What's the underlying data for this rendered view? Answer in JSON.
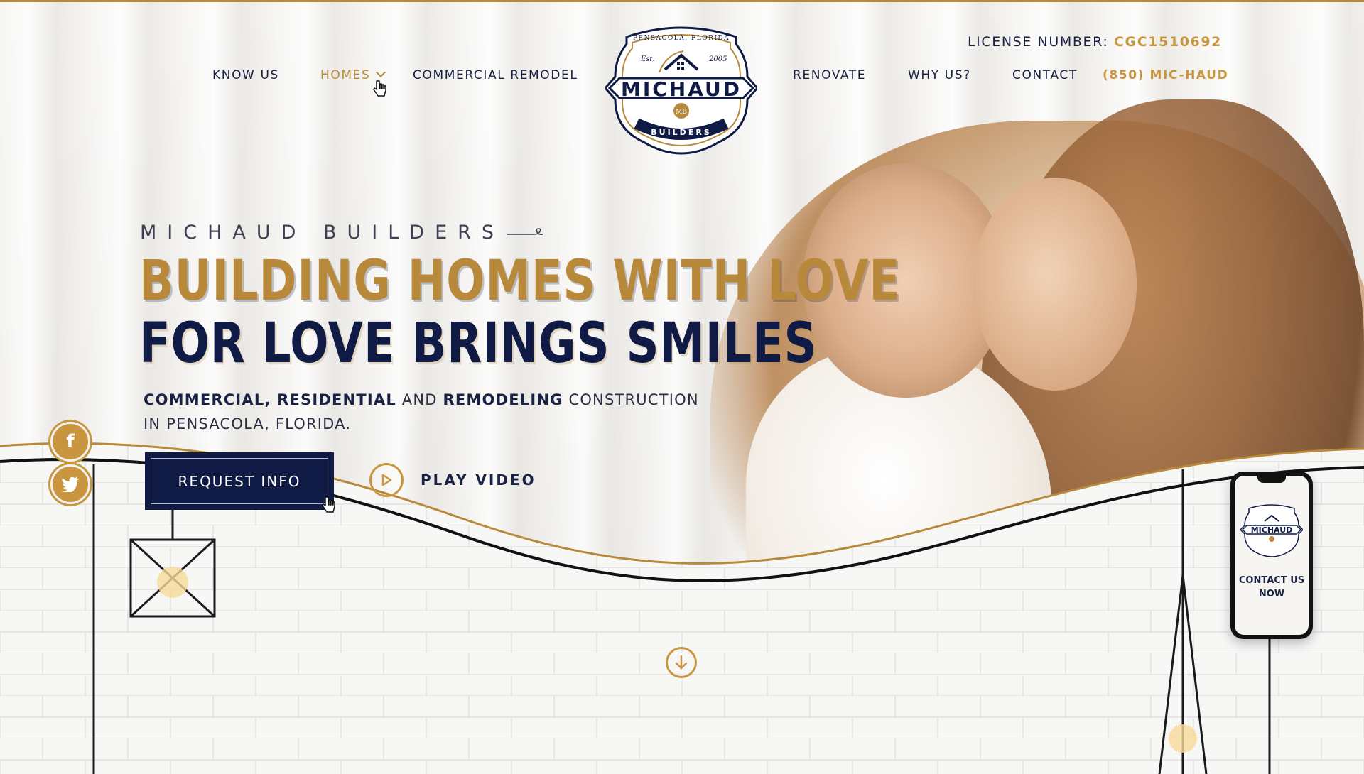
{
  "brand": {
    "logo_top_text": "PENSACOLA, FLORIDA",
    "logo_est": "Est.",
    "logo_year": "2005",
    "logo_name": "MICHAUD",
    "logo_monogram": "MB",
    "logo_bottom_text": "BUILDERS"
  },
  "license": {
    "label": "LICENSE NUMBER: ",
    "number": "CGC1510692"
  },
  "nav": {
    "left": [
      "KNOW US",
      "HOMES",
      "COMMERCIAL REMODEL"
    ],
    "right": [
      "RENOVATE",
      "WHY US?",
      "CONTACT"
    ],
    "phone": "(850) MIC-HAUD"
  },
  "hero": {
    "eyebrow": "MICHAUD BUILDERS",
    "headline_1": "BUILDING HOMES WITH LOVE",
    "headline_2": "FOR LOVE BRINGS SMILES",
    "sub_bold_1": "COMMERCIAL, RESIDENTIAL",
    "sub_text_1": " AND ",
    "sub_bold_2": "REMODELING",
    "sub_text_2": " CONSTRUCTION IN PENSACOLA, FLORIDA.",
    "cta_label": "REQUEST INFO",
    "play_label": "PLAY VIDEO"
  },
  "social": {
    "facebook": "f",
    "twitter": "t"
  },
  "phone_widget": {
    "logo_name": "MICHAUD",
    "cta": "CONTACT US NOW"
  },
  "colors": {
    "gold": "#b8893a",
    "navy": "#0f1a45",
    "background": "#f4f3f1"
  }
}
